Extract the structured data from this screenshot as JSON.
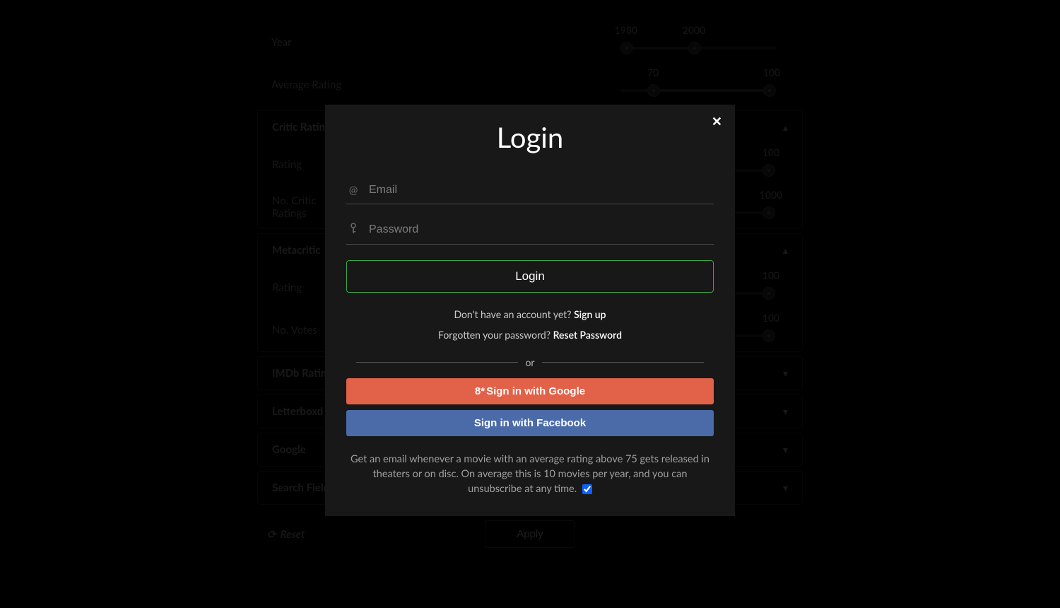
{
  "filters": {
    "year": {
      "label": "Year",
      "min": "1980",
      "max": "2000"
    },
    "avgRating": {
      "label": "Average Rating",
      "min": "70",
      "max": "100"
    },
    "critic": {
      "title": "Critic Ratings",
      "rating": {
        "label": "Rating",
        "max": "100"
      },
      "count": {
        "label": "No. Critic Ratings",
        "max": "1000"
      }
    },
    "metacritic": {
      "title": "Metacritic",
      "rating": {
        "label": "Rating",
        "max": "100"
      },
      "votes": {
        "label": "No. Votes",
        "max": "100"
      }
    },
    "collapsed": {
      "imdb": "IMDb Ratings",
      "letterboxd": "Letterboxd",
      "google": "Google",
      "search": "Search Fields"
    },
    "reset": "Reset",
    "apply": "Apply"
  },
  "modal": {
    "title": "Login",
    "email_placeholder": "Email",
    "password_placeholder": "Password",
    "login_btn": "Login",
    "signup_prompt": "Don't have an account yet? ",
    "signup_link": "Sign up",
    "forgot_prompt": "Forgotten your password? ",
    "forgot_link": "Reset Password",
    "divider": "or",
    "google": "Sign in with Google",
    "google_prefix": "8*",
    "facebook": "Sign in with Facebook",
    "disclaimer": "Get an email whenever a movie with an average rating above 75 gets released in theaters or on disc. On average this is 10 movies per year, and you can unsubscribe at any time.",
    "subscribe_checked": true
  }
}
